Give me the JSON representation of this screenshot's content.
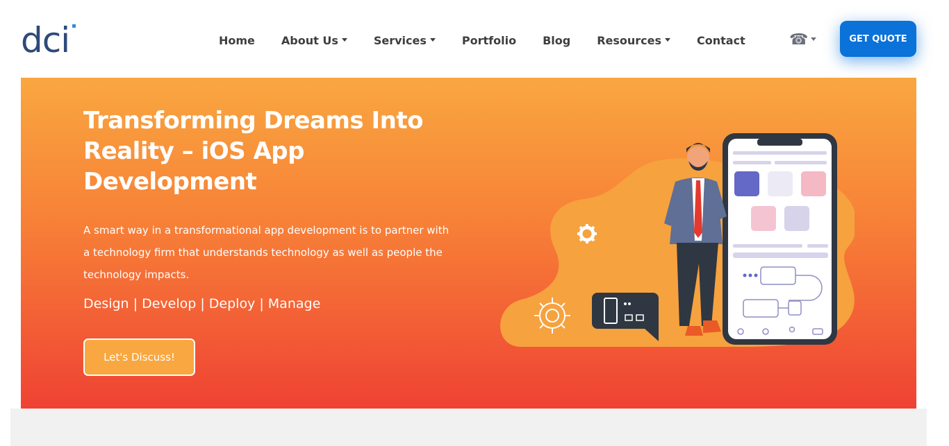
{
  "header": {
    "logo_text": "dci",
    "nav": [
      {
        "label": "Home",
        "dropdown": false
      },
      {
        "label": "About Us",
        "dropdown": true
      },
      {
        "label": "Services",
        "dropdown": true
      },
      {
        "label": "Portfolio",
        "dropdown": false
      },
      {
        "label": "Blog",
        "dropdown": false
      },
      {
        "label": "Resources",
        "dropdown": true
      },
      {
        "label": "Contact",
        "dropdown": false
      }
    ],
    "phone_icon": "phone-icon",
    "quote_button": "GET QUOTE"
  },
  "hero": {
    "title": "Transforming Dreams Into Reality – iOS App Development",
    "description": "A smart way in a transformational app development is to partner with a technology firm that understands technology as well as people the technology impacts.",
    "tagline": "Design | Develop | Deploy | Manage",
    "cta_button": "Let's Discuss!"
  },
  "colors": {
    "brand_blue": "#2d4a7a",
    "logo_accent": "#2f8fd8",
    "quote_button": "#0a72d8",
    "hero_top": "#f9a740",
    "hero_bottom": "#ef4234"
  }
}
